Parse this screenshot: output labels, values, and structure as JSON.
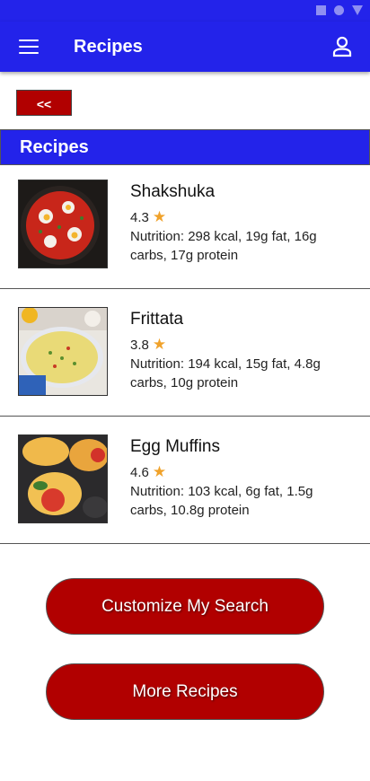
{
  "app_bar": {
    "title": "Recipes"
  },
  "back_button": {
    "label": "<<"
  },
  "section": {
    "title": "Recipes"
  },
  "recipes": [
    {
      "name": "Shakshuka",
      "rating": "4.3",
      "nutrition": "Nutrition: 298 kcal, 19g fat, 16g carbs, 17g protein"
    },
    {
      "name": "Frittata",
      "rating": "3.8",
      "nutrition": "Nutrition: 194 kcal, 15g fat, 4.8g carbs, 10g protein"
    },
    {
      "name": "Egg Muffins",
      "rating": "4.6",
      "nutrition": "Nutrition: 103 kcal, 6g fat, 1.5g carbs, 10.8g protein"
    }
  ],
  "buttons": {
    "customize": "Customize My Search",
    "more": "More Recipes"
  },
  "icons": {
    "menu": "menu-icon",
    "account": "account-icon",
    "star": "star-icon"
  },
  "colors": {
    "primary": "#2323ea",
    "accent_button": "#b10000",
    "star": "#f0a22b"
  }
}
